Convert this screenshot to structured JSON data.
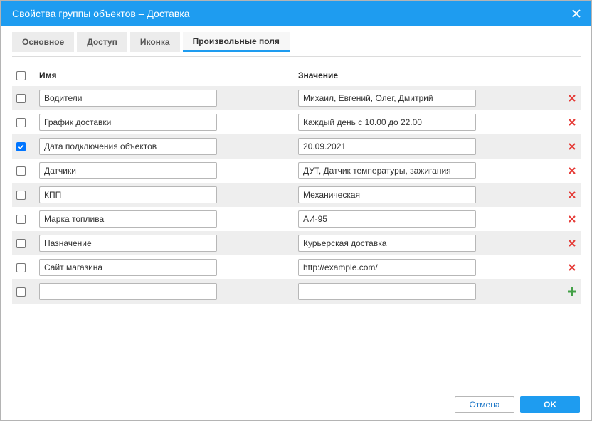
{
  "window": {
    "title": "Свойства группы объектов – Доставка"
  },
  "tabs": [
    {
      "label": "Основное",
      "active": false
    },
    {
      "label": "Доступ",
      "active": false
    },
    {
      "label": "Иконка",
      "active": false
    },
    {
      "label": "Произвольные поля",
      "active": true
    }
  ],
  "grid": {
    "headers": {
      "name": "Имя",
      "value": "Значение"
    },
    "rows": [
      {
        "name": "Водители",
        "value": "Михаил, Евгений, Олег, Дмитрий",
        "checked": false
      },
      {
        "name": "График доставки",
        "value": "Каждый день с 10.00 до 22.00",
        "checked": false
      },
      {
        "name": "Дата подключения объектов",
        "value": "20.09.2021",
        "checked": true
      },
      {
        "name": "Датчики",
        "value": "ДУТ, Датчик температуры, зажигания",
        "checked": false
      },
      {
        "name": "КПП",
        "value": "Механическая",
        "checked": false
      },
      {
        "name": "Марка топлива",
        "value": "АИ-95",
        "checked": false
      },
      {
        "name": "Назначение",
        "value": "Курьерская доставка",
        "checked": false
      },
      {
        "name": "Сайт магазина",
        "value": "http://example.com/",
        "checked": false
      }
    ],
    "new_row": {
      "name": "",
      "value": ""
    }
  },
  "footer": {
    "cancel_label": "Отмена",
    "ok_label": "OK"
  },
  "icons": {
    "close": "close-icon",
    "delete": "delete-icon",
    "add": "add-icon",
    "check": "check-icon"
  },
  "colors": {
    "accent": "#1e9cf0",
    "delete": "#e53935",
    "add": "#43a047",
    "checkbox_checked": "#0075ff"
  }
}
